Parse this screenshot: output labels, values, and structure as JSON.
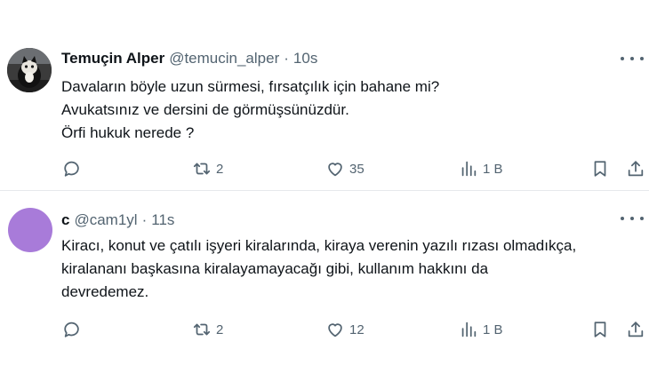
{
  "tweets": [
    {
      "author_name": "Temuçin Alper",
      "handle": "@temucin_alper",
      "separator": "·",
      "time": "10s",
      "avatar_icon": "profile-photo-cat",
      "text_lines": [
        "Davaların böyle uzun sürmesi, fırsatçılık için bahane mi?",
        "Avukatsınız ve dersini de görmüşsünüzdür.",
        "Örfi hukuk nerede ?"
      ],
      "retweets": "2",
      "likes": "35",
      "views": "1 B"
    },
    {
      "author_name": "c",
      "handle": "@cam1yl",
      "separator": "·",
      "time": "11s",
      "avatar_color": "#a87bd9",
      "text_lines": [
        "Kiracı, konut ve çatılı işyeri kiralarında, kiraya verenin yazılı rızası olmadıkça,",
        "kiralananı başkasına kiralayamayacağı gibi, kullanım hakkını da",
        "devredemez."
      ],
      "retweets": "2",
      "likes": "12",
      "views": "1 B"
    }
  ],
  "icons": {
    "reply": "comment-icon",
    "retweet": "retweet-icon",
    "like": "heart-icon",
    "views": "views-chart-icon",
    "bookmark": "bookmark-icon",
    "share": "share-icon",
    "more": "more-dots-icon"
  },
  "colors": {
    "text": "#0f1419",
    "secondary": "#536471",
    "divider": "#e6e9ec"
  }
}
